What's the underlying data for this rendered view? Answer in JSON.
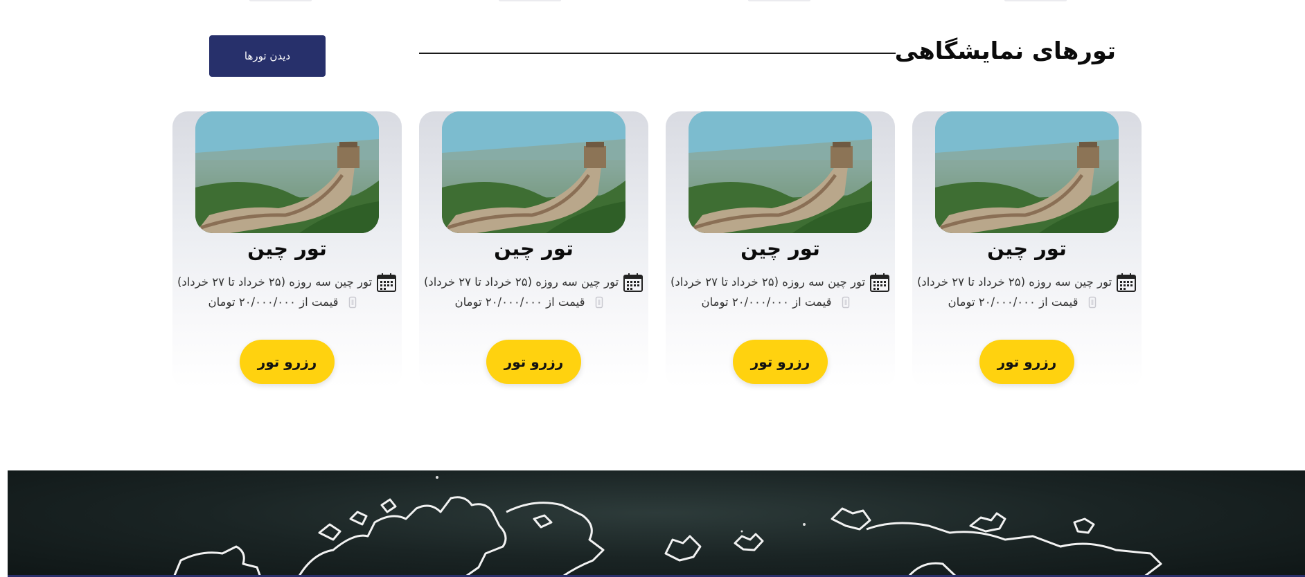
{
  "section": {
    "title": "تورهای نمایشگاهی",
    "view_tours_label": "دیدن تورها"
  },
  "tours": [
    {
      "title": "تور چین",
      "dates": "تور چین سه روزه (۲۵ خرداد تا ۲۷ خرداد)",
      "price": "قیمت از ۲۰/۰۰۰/۰۰۰ تومان",
      "reserve_label": "رزرو تور"
    },
    {
      "title": "تور چین",
      "dates": "تور چین سه روزه (۲۵ خرداد تا ۲۷ خرداد)",
      "price": "قیمت از ۲۰/۰۰۰/۰۰۰ تومان",
      "reserve_label": "رزرو تور"
    },
    {
      "title": "تور چین",
      "dates": "تور چین سه روزه (۲۵ خرداد تا ۲۷ خرداد)",
      "price": "قیمت از ۲۰/۰۰۰/۰۰۰ تومان",
      "reserve_label": "رزرو تور"
    },
    {
      "title": "تور چین",
      "dates": "تور چین سه روزه (۲۵ خرداد تا ۲۷ خرداد)",
      "price": "قیمت از ۲۰/۰۰۰/۰۰۰ تومان",
      "reserve_label": "رزرو تور"
    }
  ],
  "icons": {
    "calendar": "calendar-icon",
    "price_tag": "price-tag-icon",
    "card_image": "great-wall-image",
    "banner": "world-map-chalkboard"
  },
  "colors": {
    "primary_button": "#27306b",
    "reserve_button": "#ffd20f",
    "card_background_top": "#d9dbe2",
    "banner_background": "#1a2424"
  }
}
